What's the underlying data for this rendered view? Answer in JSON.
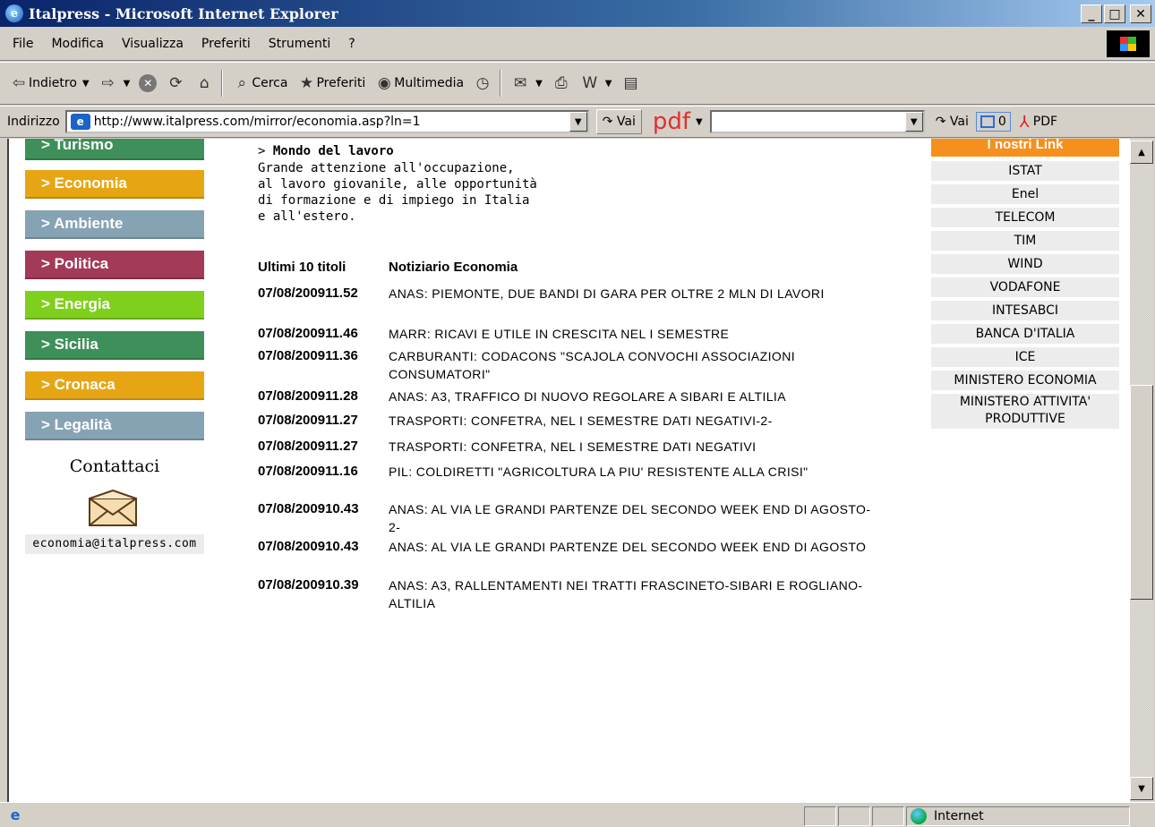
{
  "window": {
    "title": "Italpress - Microsoft Internet Explorer",
    "icon": "ie-icon",
    "min": "_",
    "max": "□",
    "close": "✕"
  },
  "menu": [
    "File",
    "Modifica",
    "Visualizza",
    "Preferiti",
    "Strumenti",
    "?"
  ],
  "toolbar": {
    "back": "Indietro",
    "search": "Cerca",
    "favorites": "Preferiti",
    "media": "Multimedia"
  },
  "address": {
    "label": "Indirizzo",
    "url": "http://www.italpress.com/mirror/economia.asp?ln=1",
    "go": "Vai",
    "pdf": "pdf",
    "go2": "Vai",
    "count": "0",
    "pdf_btn": "PDF"
  },
  "sidebar": {
    "items": [
      {
        "label": "> Turismo",
        "color": "#3f8f5a"
      },
      {
        "label": "> Economia",
        "color": "#e6a614"
      },
      {
        "label": "> Ambiente",
        "color": "#86a3b4"
      },
      {
        "label": "> Politica",
        "color": "#a23a58"
      },
      {
        "label": "> Energia",
        "color": "#7fd01c"
      },
      {
        "label": "> Sicilia",
        "color": "#3f8f5a"
      },
      {
        "label": "> Cronaca",
        "color": "#e6a614"
      },
      {
        "label": "> Legalità",
        "color": "#86a3b4"
      }
    ],
    "contact_title": "Contattaci",
    "email": "economia@italpress.com"
  },
  "main": {
    "section_prefix": "> ",
    "section_title": "Mondo del lavoro",
    "section_desc": [
      "Grande attenzione all'occupazione,",
      "al lavoro giovanile, alle opportunità",
      "di formazione e di impiego in Italia",
      "e all'estero."
    ],
    "col_latest": "Ultimi 10 titoli",
    "col_news": "Notiziario Economia",
    "news": [
      {
        "ts": "07/08/200911.52",
        "title": "ANAS: PIEMONTE, DUE BANDI DI GARA PER OLTRE 2 MLN DI LAVORI"
      },
      {
        "ts": "07/08/200911.46",
        "title": "MARR: RICAVI E UTILE IN CRESCITA NEL I SEMESTRE"
      },
      {
        "ts": "07/08/200911.36",
        "title": "CARBURANTI: CODACONS \"SCAJOLA CONVOCHI ASSOCIAZIONI CONSUMATORI\""
      },
      {
        "ts": "07/08/200911.28",
        "title": "ANAS: A3, TRAFFICO DI NUOVO REGOLARE A SIBARI E ALTILIA"
      },
      {
        "ts": "07/08/200911.27",
        "title": "TRASPORTI: CONFETRA, NEL I SEMESTRE DATI NEGATIVI-2-"
      },
      {
        "ts": "07/08/200911.27",
        "title": "TRASPORTI: CONFETRA, NEL I SEMESTRE DATI NEGATIVI"
      },
      {
        "ts": "07/08/200911.16",
        "title": "PIL: COLDIRETTI \"AGRICOLTURA LA PIU' RESISTENTE ALLA CRISI\""
      },
      {
        "ts": "07/08/200910.43",
        "title": "ANAS: AL VIA LE GRANDI PARTENZE DEL SECONDO WEEK END DI AGOSTO-2-"
      },
      {
        "ts": "07/08/200910.43",
        "title": "ANAS: AL VIA LE GRANDI PARTENZE DEL SECONDO WEEK END DI AGOSTO"
      },
      {
        "ts": "07/08/200910.39",
        "title": "ANAS: A3, RALLENTAMENTI NEI TRATTI FRASCINETO-SIBARI E ROGLIANO-ALTILIA"
      }
    ]
  },
  "links": {
    "header": "I nostri Link",
    "items": [
      "ISTAT",
      "Enel",
      "TELECOM",
      "TIM",
      "WIND",
      "VODAFONE",
      "INTESABCI",
      "BANCA D'ITALIA",
      "ICE",
      "MINISTERO ECONOMIA",
      "MINISTERO ATTIVITA' PRODUTTIVE"
    ]
  },
  "status": {
    "zone": "Internet"
  }
}
